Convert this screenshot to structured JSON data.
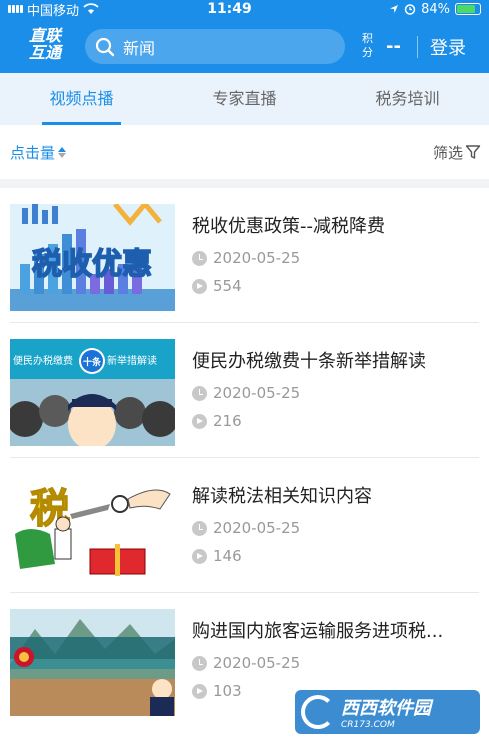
{
  "status_bar": {
    "carrier": "中国移动",
    "time": "11:49",
    "battery_text": "84%",
    "icons": [
      "signal-icon",
      "wifi-icon",
      "location-arrow-icon",
      "alarm-icon",
      "battery-icon"
    ]
  },
  "header": {
    "logo_line1": "直联",
    "logo_line2": "互通",
    "search_value": "新闻",
    "points_label": "积分",
    "points_value": "--",
    "login_label": "登录"
  },
  "tabs": [
    {
      "label": "视频点播",
      "active": true
    },
    {
      "label": "专家直播",
      "active": false
    },
    {
      "label": "税务培训",
      "active": false
    }
  ],
  "sort_bar": {
    "sort_label": "点击量",
    "filter_label": "筛选"
  },
  "videos": [
    {
      "title": "税收优惠政策--减税降费",
      "date": "2020-05-25",
      "views": "554",
      "thumb_text": "税收优惠"
    },
    {
      "title": "便民办税缴费十条新举措解读",
      "date": "2020-05-25",
      "views": "216",
      "thumb_text_left": "便民办税缴费",
      "thumb_badge": "十条",
      "thumb_text_right": "新举措解读"
    },
    {
      "title": "解读税法相关知识内容",
      "date": "2020-05-25",
      "views": "146",
      "thumb_text": "税"
    },
    {
      "title": "购进国内旅客运输服务进项税...",
      "date": "2020-05-25",
      "views": "103"
    }
  ],
  "watermark": {
    "brand": "西西软件园",
    "site": "CR173.COM"
  },
  "colors": {
    "primary": "#1a8ee8",
    "tab_bg": "#eaf3fc",
    "meta_gray": "#999999"
  }
}
